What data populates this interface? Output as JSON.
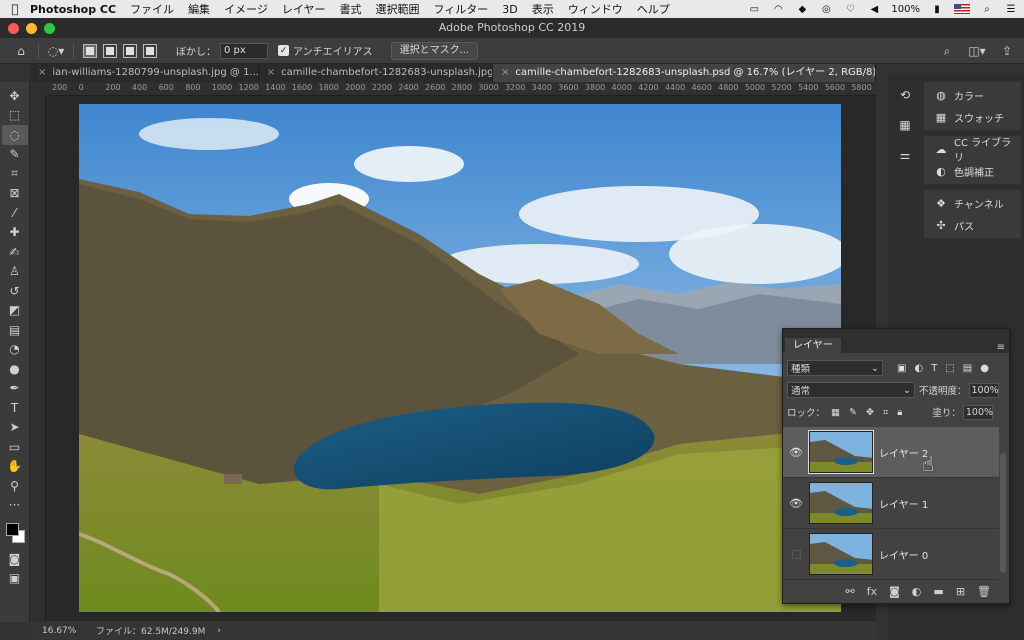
{
  "menubar": {
    "app_name": "Photoshop CC",
    "menus": [
      "ファイル",
      "編集",
      "イメージ",
      "レイヤー",
      "書式",
      "選択範囲",
      "フィルター",
      "3D",
      "表示",
      "ウィンドウ",
      "ヘルプ"
    ],
    "battery": "100%"
  },
  "window": {
    "title": "Adobe Photoshop CC 2019"
  },
  "options": {
    "feather_label": "ぼかし：",
    "feather_value": "0 px",
    "antialias_label": "アンチエイリアス",
    "antialias_checked": true,
    "select_mask_label": "選択とマスク..."
  },
  "tabs": [
    {
      "label": "ian-williams-1280799-unsplash.jpg @ 1...",
      "active": false
    },
    {
      "label": "camille-chambefort-1282683-unsplash.jpg",
      "active": false
    },
    {
      "label": "camille-chambefort-1282683-unsplash.psd @ 16.7% (レイヤー 2, RGB/8) *",
      "active": true
    }
  ],
  "ruler": {
    "ticks": [
      "200",
      "0",
      "200",
      "400",
      "600",
      "800",
      "1000",
      "1200",
      "1400",
      "1600",
      "1800",
      "2000",
      "2200",
      "2400",
      "2600",
      "2800",
      "3000",
      "3200",
      "3400",
      "3600",
      "3800",
      "4000",
      "4200",
      "4400",
      "4600",
      "4800",
      "5000",
      "5200",
      "5400",
      "5600",
      "5800"
    ]
  },
  "status": {
    "zoom": "16.67%",
    "file_info": "ファイル：62.5M/249.9M",
    "arrow": "›"
  },
  "dock": {
    "groups": [
      [
        "カラー",
        "スウォッチ"
      ],
      [
        "CC ライブラリ",
        "色調補正"
      ],
      [
        "チャンネル",
        "パス"
      ]
    ]
  },
  "layers_panel": {
    "tab_label": "レイヤー",
    "filter_label": "種類",
    "blend_mode": "通常",
    "opacity_label": "不透明度：",
    "opacity_value": "100%",
    "lock_label": "ロック：",
    "fill_label": "塗り：",
    "fill_value": "100%",
    "layers": [
      {
        "name": "レイヤー 2",
        "visible": true,
        "selected": true
      },
      {
        "name": "レイヤー 1",
        "visible": true,
        "selected": false
      },
      {
        "name": "レイヤー 0",
        "visible": false,
        "selected": false
      }
    ]
  }
}
